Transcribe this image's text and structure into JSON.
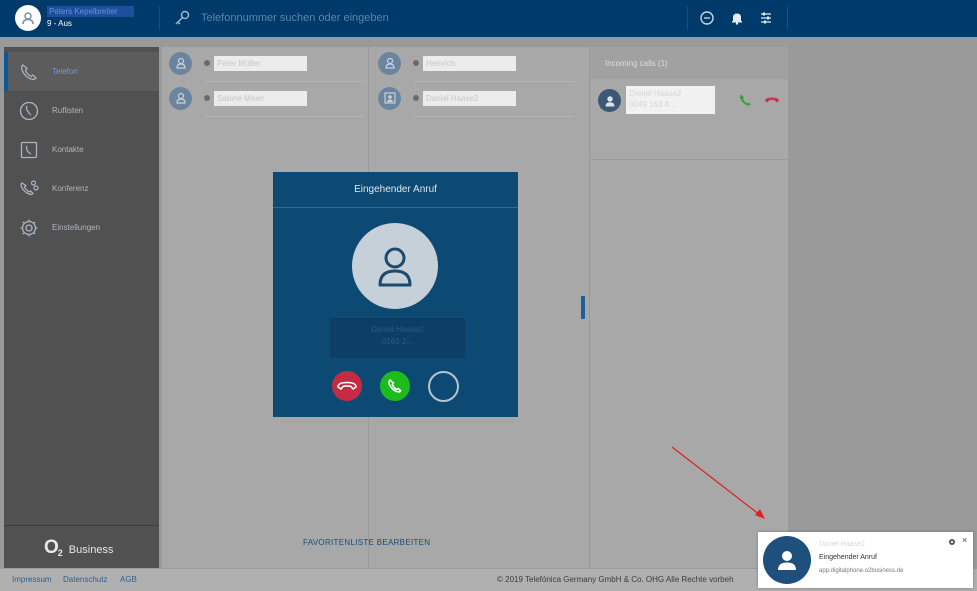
{
  "header": {
    "user_name": "Peters Kepelbreiter",
    "user_status": "9 - Aus",
    "search_placeholder": "Telefonnummer suchen oder eingeben"
  },
  "sidebar": {
    "items": [
      {
        "label": "Telefon",
        "icon": "phone-icon",
        "active": true
      },
      {
        "label": "Ruflisten",
        "icon": "call-list-icon",
        "active": false
      },
      {
        "label": "Kontakte",
        "icon": "contacts-icon",
        "active": false
      },
      {
        "label": "Konferenz",
        "icon": "conference-icon",
        "active": false
      },
      {
        "label": "Einstellungen",
        "icon": "gear-icon",
        "active": false
      }
    ],
    "brand_o": "O",
    "brand_sub": "2",
    "brand_business": "Business"
  },
  "favorites": {
    "left": [
      {
        "name": "Peter Müller"
      },
      {
        "name": "Sabine Maier"
      }
    ],
    "right": [
      {
        "name": "Heinrich"
      },
      {
        "name": "Daniel Haase2"
      }
    ],
    "edit_label": "FAVORITENLISTE BEARBEITEN"
  },
  "incoming": {
    "title": "Incoming calls (1)",
    "caller_name": "Daniel Haase2",
    "caller_number": "0049 163 4..."
  },
  "modal": {
    "title": "Eingehender Anruf",
    "caller_name": "Daniel Haase2",
    "caller_number": "0163 2..."
  },
  "footer": {
    "impressum": "Impressum",
    "datenschutz": "Datenschutz",
    "agb": "AGB",
    "copyright": "© 2019 Telefónica Germany GmbH & Co. OHG Alle Rechte vorbeh"
  },
  "toast": {
    "caller_name": "Daniel Haase2",
    "title": "Eingehender Anruf",
    "source": "app.digitalphone.o2business.de",
    "close": "×"
  },
  "colors": {
    "header_bg": "#003a6b",
    "sidebar_bg": "#515151",
    "modal_bg": "#0c4a73",
    "accept": "#1dbb1d",
    "decline": "#c72a43",
    "arrow": "#e02020"
  }
}
